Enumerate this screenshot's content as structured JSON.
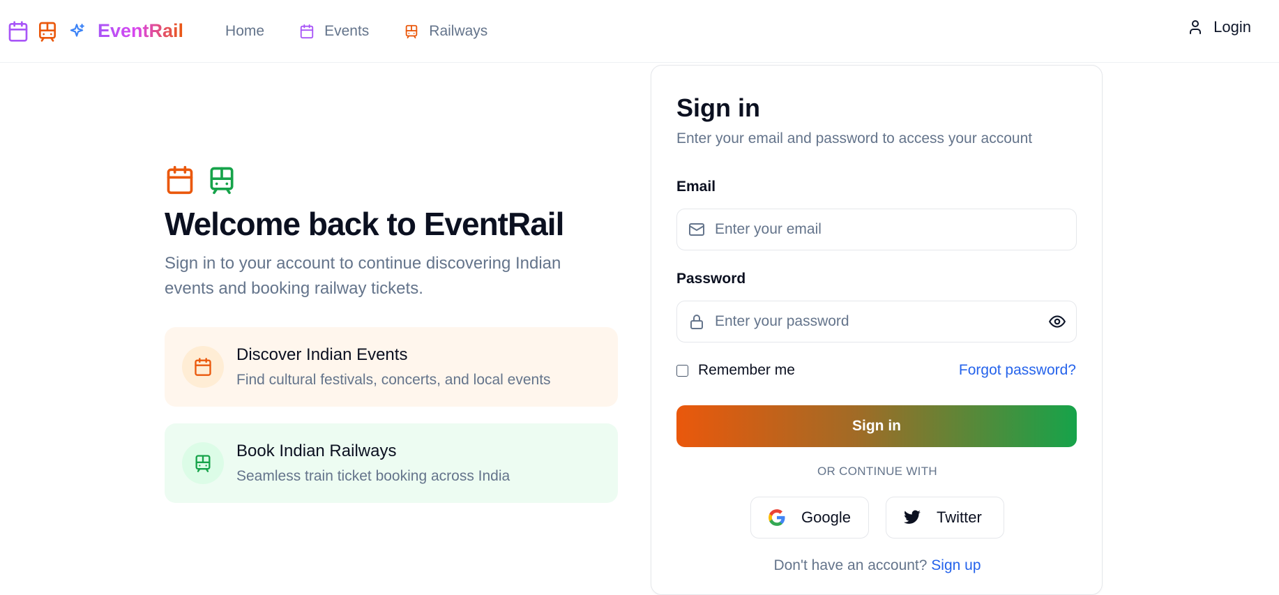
{
  "header": {
    "brand": "EventRail",
    "nav": [
      {
        "label": "Home",
        "icon": ""
      },
      {
        "label": "Events",
        "icon": "calendar-icon"
      },
      {
        "label": "Railways",
        "icon": "train-icon"
      }
    ],
    "login_label": "Login"
  },
  "hero": {
    "title": "Welcome back to EventRail",
    "subtitle": "Sign in to your account to continue discovering Indian events and booking railway tickets."
  },
  "features": [
    {
      "title": "Discover Indian Events",
      "description": "Find cultural festivals, concerts, and local events",
      "icon": "calendar-icon"
    },
    {
      "title": "Book Indian Railways",
      "description": "Seamless train ticket booking across India",
      "icon": "train-icon"
    }
  ],
  "signin": {
    "title": "Sign in",
    "subtitle": "Enter your email and password to access your account",
    "email_label": "Email",
    "email_placeholder": "Enter your email",
    "password_label": "Password",
    "password_placeholder": "Enter your password",
    "remember_label": "Remember me",
    "forgot_label": "Forgot password?",
    "button_label": "Sign in",
    "divider": "OR CONTINUE WITH",
    "google_label": "Google",
    "twitter_label": "Twitter",
    "signup_prompt": "Don't have an account?",
    "signup_link": "Sign up"
  },
  "colors": {
    "accent_orange": "#ea580c",
    "accent_green": "#16a34a",
    "accent_purple": "#a855f7",
    "link_blue": "#2563eb"
  }
}
